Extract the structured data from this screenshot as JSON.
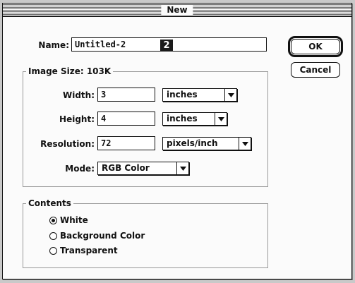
{
  "dialog": {
    "title": "New"
  },
  "name": {
    "label": "Name:",
    "value": "Untitled-2",
    "badge": "2"
  },
  "image_size": {
    "label": "Image Size: 103K",
    "width": {
      "label": "Width:",
      "value": "3",
      "unit": "inches"
    },
    "height": {
      "label": "Height:",
      "value": "4",
      "unit": "inches"
    },
    "resolution": {
      "label": "Resolution:",
      "value": "72",
      "unit": "pixels/inch"
    },
    "mode": {
      "label": "Mode:",
      "value": "RGB Color"
    }
  },
  "contents": {
    "label": "Contents",
    "options": [
      {
        "label": "White",
        "selected": true
      },
      {
        "label": "Background Color",
        "selected": false
      },
      {
        "label": "Transparent",
        "selected": false
      }
    ]
  },
  "buttons": {
    "ok_label": "OK",
    "cancel_label": "Cancel"
  },
  "icons": {
    "dropdown_arrow": "chevron-down-icon",
    "radio": "radio-button-icon"
  },
  "colors": {
    "background": "#c9c9c9",
    "dialog": "#fbfbfb",
    "ink": "#111111"
  }
}
